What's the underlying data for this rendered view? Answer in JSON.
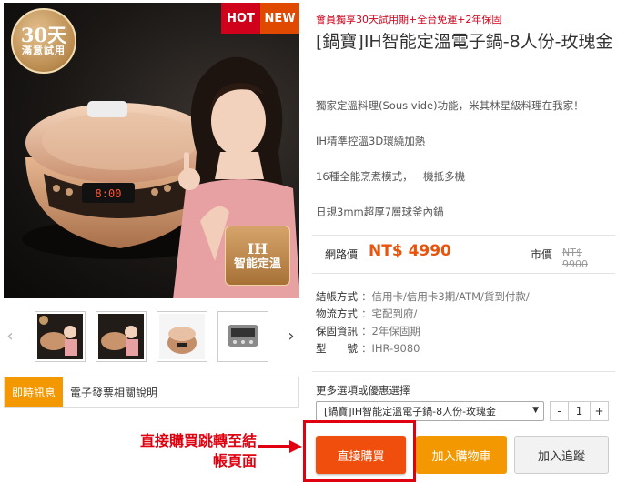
{
  "hero": {
    "badge_30_big": "30天",
    "badge_30_small": "滿意試用",
    "hot_label": "HOT",
    "new_label": "NEW",
    "ih_line1": "IH",
    "ih_line2": "智能定溫"
  },
  "thumbnails": [
    {
      "alt": "thumbnail-1"
    },
    {
      "alt": "thumbnail-2"
    },
    {
      "alt": "thumbnail-3"
    },
    {
      "alt": "thumbnail-4"
    }
  ],
  "news": {
    "tag": "即時訊息",
    "text": "電子發票相關說明"
  },
  "product": {
    "promo": "會員獨享30天試用期+全台免運+2年保固",
    "title": "[鍋寶]IH智能定溫電子鍋-8人份-玫瑰金",
    "features": [
      "獨家定溫料理(Sous vide)功能，米其林星級料理在我家！",
      "IH精準控溫3D環繞加熱",
      "16種全能烹煮模式，一機抵多機",
      "日規3mm超厚7層球釜內鍋"
    ],
    "price_label": "網路價",
    "price": "NT$ 4990",
    "market_label": "市價",
    "market_price": "NT$ 9900"
  },
  "specs": [
    {
      "key": "結帳方式",
      "value": "：信用卡/信用卡3期/ATM/貨到付款/"
    },
    {
      "key": "物流方式",
      "value": "：宅配到府/"
    },
    {
      "key": "保固資訊",
      "value": "：2年保固期"
    },
    {
      "key": "型　　號",
      "value": "：IHR-9080"
    }
  ],
  "options": {
    "label": "更多選項或優惠選擇",
    "selected": "[鍋寶]IH智能定溫電子鍋-8人份-玫瑰金",
    "qty_minus": "-",
    "qty_value": "1",
    "qty_plus": "+"
  },
  "buttons": {
    "buy": "直接購買",
    "cart": "加入購物車",
    "track": "加入追蹤"
  },
  "annotation": {
    "line1": "直接購買跳轉至結",
    "line2": "帳頁面",
    "color": "#e0000f"
  }
}
